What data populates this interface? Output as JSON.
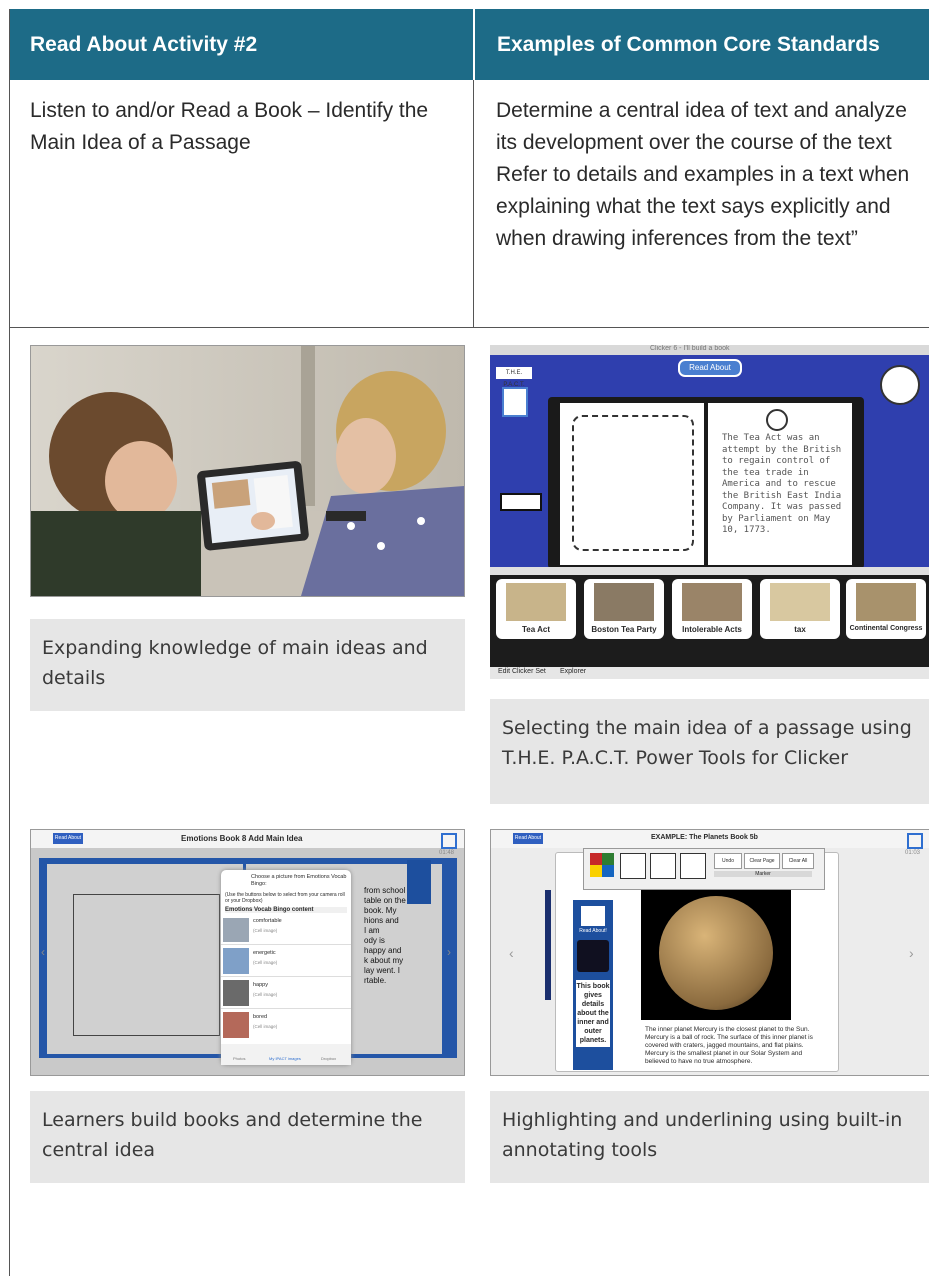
{
  "table": {
    "header_left": "Read About Activity #2",
    "header_right": "Examples of Common Core Standards",
    "activity": "Listen to and/or Read a Book – Identify the Main Idea of a Passage",
    "standards": [
      "Determine a central idea of text and analyze its development over the course of the text",
      "Refer to details and examples in a text when explaining what the text says explicitly and when drawing inferences from the text”"
    ]
  },
  "captions": {
    "photo": "Expanding knowledge of main ideas and details",
    "clicker": "Selecting the main idea of a passage using T.H.E. P.A.C.T. Power Tools for Clicker",
    "emotions": "Learners build books and determine the central idea",
    "planets": "Highlighting and underlining using built-in annotating tools"
  },
  "clicker": {
    "window_title": "Clicker 6 - I'll build a book",
    "read_about_button": "Read About",
    "logo": "T.H.E. P.A.C.T.",
    "passage": "The Tea Act was an attempt by the British to regain control of the tea trade in America and to rescue the British East India Company. It was passed by Parliament on May 10, 1773.",
    "cells": [
      "Tea Act",
      "Boston Tea Party",
      "Intolerable Acts",
      "tax",
      "Continental Congress"
    ],
    "bottom_tabs": [
      "Edit Clicker Set",
      "Explorer"
    ]
  },
  "emotions": {
    "title": "Emotions Book 8 Add Main Idea",
    "read_about_button": "Read About",
    "time": "01:48",
    "popup_header": "Choose a picture from Emotions Vocab Bingo:",
    "popup_hint": "(Use the buttons below to select from your camera roll or your Dropbox)",
    "popup_section": "Emotions Vocab Bingo content",
    "items": [
      {
        "label": "comfortable",
        "sub": "(Cell image)"
      },
      {
        "label": "energetic",
        "sub": "(Cell image)"
      },
      {
        "label": "happy",
        "sub": "(Cell image)"
      },
      {
        "label": "bored",
        "sub": "(Cell image)"
      }
    ],
    "tabs": [
      "Photos",
      "My IPACT images",
      "Dropbox"
    ],
    "page_text_lines": [
      "from school I",
      "table on the",
      "book. My",
      "hions and",
      "I am",
      "ody is",
      "happy and",
      "k about my",
      "lay went. I",
      "rtable."
    ]
  },
  "planets": {
    "title": "EXAMPLE: The Planets Book 5b",
    "read_about_button": "Read About",
    "time": "01:03",
    "tool_buttons": [
      "Undo",
      "Clear Page",
      "Clear All"
    ],
    "tool_label": "Marker",
    "ribbon_label": "Read About!",
    "ribbon_text": "This book gives details about the inner and outer planets.",
    "passage": "The inner planet Mercury is the closest planet to the Sun. Mercury is a ball of rock. The surface of this inner planet is covered with craters, jagged mountains, and flat plains. Mercury is the smallest planet in our Solar System and believed to have no true atmosphere."
  }
}
